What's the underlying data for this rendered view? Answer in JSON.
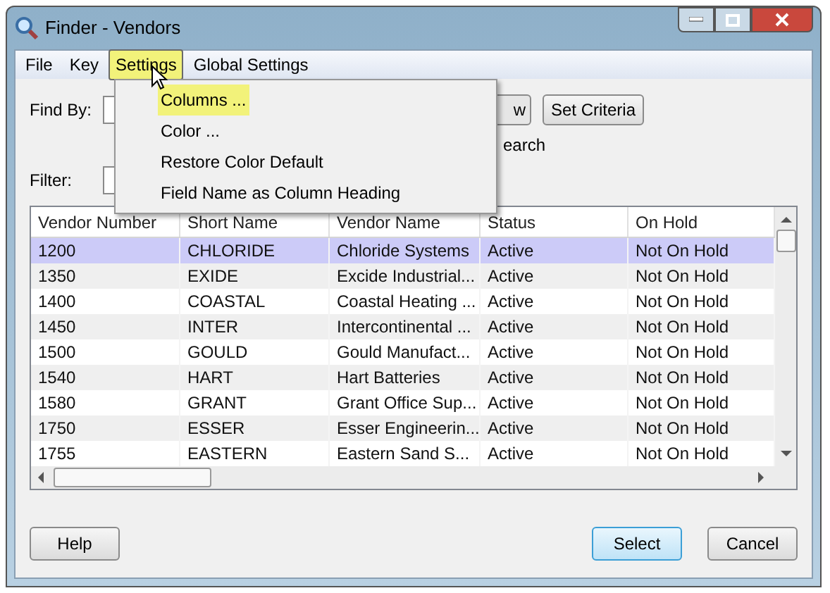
{
  "window": {
    "title": "Finder - Vendors"
  },
  "menu_bar": [
    {
      "label": "File",
      "selected": false,
      "highlighted": false
    },
    {
      "label": "Key",
      "selected": false,
      "highlighted": false
    },
    {
      "label": "Settings",
      "selected": true,
      "highlighted": true
    },
    {
      "label": "Global Settings",
      "selected": false,
      "highlighted": false
    }
  ],
  "settings_menu": [
    {
      "label": "Columns ...",
      "highlighted": true
    },
    {
      "label": "Color ...",
      "highlighted": false
    },
    {
      "label": "Restore Color Default",
      "highlighted": false
    },
    {
      "label": "Field Name as Column Heading",
      "highlighted": false
    }
  ],
  "find_by": {
    "label": "Find By:",
    "button_partial": "w",
    "set_criteria": "Set Criteria",
    "option_partial": "earch"
  },
  "filter": {
    "label": "Filter:"
  },
  "table": {
    "columns": [
      "Vendor Number",
      "Short Name",
      "Vendor Name",
      "Status",
      "On Hold"
    ],
    "rows": [
      {
        "cells": [
          "1200",
          "CHLORIDE",
          "Chloride Systems",
          "Active",
          "Not On Hold"
        ],
        "selected": true
      },
      {
        "cells": [
          "1350",
          "EXIDE",
          "Excide Industrial...",
          "Active",
          "Not On Hold"
        ],
        "selected": false
      },
      {
        "cells": [
          "1400",
          "COASTAL",
          "Coastal Heating ...",
          "Active",
          "Not On Hold"
        ],
        "selected": false
      },
      {
        "cells": [
          "1450",
          "INTER",
          "Intercontinental ...",
          "Active",
          "Not On Hold"
        ],
        "selected": false
      },
      {
        "cells": [
          "1500",
          "GOULD",
          "Gould Manufact...",
          "Active",
          "Not On Hold"
        ],
        "selected": false
      },
      {
        "cells": [
          "1540",
          "HART",
          "Hart Batteries",
          "Active",
          "Not On Hold"
        ],
        "selected": false
      },
      {
        "cells": [
          "1580",
          "GRANT",
          "Grant Office Sup...",
          "Active",
          "Not On Hold"
        ],
        "selected": false
      },
      {
        "cells": [
          "1750",
          "ESSER",
          "Esser Engineerin...",
          "Active",
          "Not On Hold"
        ],
        "selected": false
      },
      {
        "cells": [
          "1755",
          "EASTERN",
          "Eastern Sand S...",
          "Active",
          "Not On Hold"
        ],
        "selected": false
      }
    ]
  },
  "buttons": [
    {
      "label": "Help",
      "kind": "normal"
    },
    {
      "label": "Select",
      "kind": "default"
    },
    {
      "label": "Cancel",
      "kind": "normal"
    }
  ]
}
